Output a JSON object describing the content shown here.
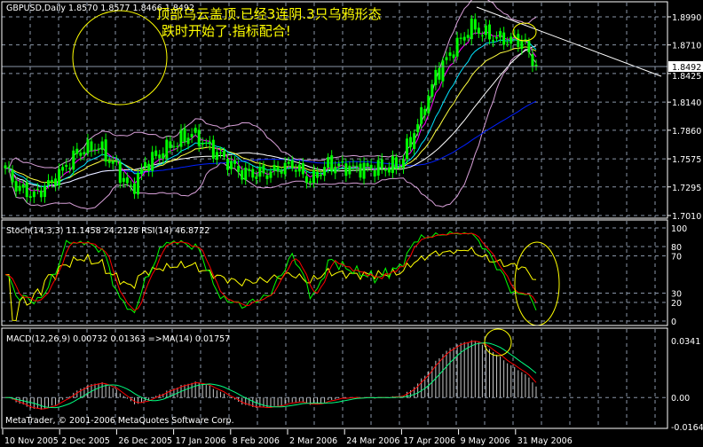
{
  "header": {
    "symbol": "GBPUSD,Daily",
    "ohlc": "1.8570 1.8577 1.8466 1.8492"
  },
  "annotation": {
    "line1": "顶部乌云盖顶.已经3连阴.3只乌鸦形态",
    "line2": "跌时开始了.指标配合!"
  },
  "colors": {
    "background": "#000000",
    "grid": "#8a96a8",
    "candle": "#00ff00",
    "annotation": "#ffff00",
    "bollinger": "#d8a0d8",
    "ma_fast": "#ff00ff",
    "ma_cyan": "#00e5ff",
    "ma_yellow": "#ffff40",
    "ma_white": "#ffffff",
    "ma_blue": "#0020ff",
    "stoch_main": "#00ff00",
    "stoch_signal": "#ff0000",
    "rsi": "#ffff00",
    "macd_hist": "#c8c8c8",
    "macd_red": "#ff0000",
    "macd_green": "#00ff80"
  },
  "chart_data": [
    {
      "type": "candlestick",
      "title": "GBPUSD,Daily",
      "price_axis_ticks": [
        "1.8990",
        "1.8710",
        "1.8425",
        "1.8140",
        "1.7860",
        "1.7575",
        "1.7295",
        "1.7010"
      ],
      "current_price": "1.8492",
      "ylim": [
        1.701,
        1.899
      ],
      "date_ticks": [
        "10 Nov 2005",
        "2 Dec 2005",
        "26 Dec 2005",
        "17 Jan 2006",
        "8 Feb 2006",
        "2 Mar 2006",
        "24 Mar 2006",
        "17 Apr 2006",
        "9 May 2006",
        "31 May 2006"
      ],
      "approx_close_path": [
        [
          "2005-11-10",
          1.748
        ],
        [
          "2005-11-15",
          1.73
        ],
        [
          "2005-11-22",
          1.721
        ],
        [
          "2005-11-29",
          1.735
        ],
        [
          "2005-12-09",
          1.766
        ],
        [
          "2005-12-16",
          1.77
        ],
        [
          "2005-12-23",
          1.748
        ],
        [
          "2005-12-29",
          1.726
        ],
        [
          "2006-01-04",
          1.752
        ],
        [
          "2006-01-13",
          1.77
        ],
        [
          "2006-01-23",
          1.783
        ],
        [
          "2006-01-31",
          1.766
        ],
        [
          "2006-02-10",
          1.743
        ],
        [
          "2006-02-21",
          1.743
        ],
        [
          "2006-03-02",
          1.752
        ],
        [
          "2006-03-09",
          1.735
        ],
        [
          "2006-03-16",
          1.752
        ],
        [
          "2006-03-27",
          1.748
        ],
        [
          "2006-04-06",
          1.748
        ],
        [
          "2006-04-13",
          1.752
        ],
        [
          "2006-04-20",
          1.792
        ],
        [
          "2006-04-25",
          1.819
        ],
        [
          "2006-04-27",
          1.841
        ],
        [
          "2006-05-04",
          1.867
        ],
        [
          "2006-05-11",
          1.889
        ],
        [
          "2006-05-18",
          1.88
        ],
        [
          "2006-05-25",
          1.876
        ],
        [
          "2006-05-31",
          1.876
        ],
        [
          "2006-06-02",
          1.863
        ],
        [
          "2006-06-06",
          1.8492
        ]
      ],
      "overlays": [
        "Bollinger Bands",
        "Moving averages",
        "Trendline"
      ]
    },
    {
      "type": "line",
      "title": "Stoch(14,3,3) 11.1458 24.2128  RSI(14) 46.8722",
      "ticks": [
        "100",
        "80",
        "70",
        "30",
        "20",
        "0"
      ],
      "ylim": [
        0,
        100
      ],
      "series": [
        {
          "name": "Stoch(14,3,3) main",
          "last": 11.1458
        },
        {
          "name": "Stoch(14,3,3) signal",
          "last": 24.2128
        },
        {
          "name": "RSI(14)",
          "last": 46.8722
        }
      ]
    },
    {
      "type": "bar",
      "title": "MACD(12,26,9) 0.00732 0.01363  =>MA(14) 0.01757",
      "ticks": [
        "0.0341",
        "0.00",
        "-0.0164"
      ],
      "ylim": [
        -0.0164,
        0.0341
      ],
      "series": [
        {
          "name": "MACD(12,26,9)",
          "last": 0.00732
        },
        {
          "name": "Signal",
          "last": 0.01363
        },
        {
          "name": "=>MA(14)",
          "last": 0.01757
        }
      ]
    }
  ],
  "footer": {
    "copyright": "MetaTrader, © 2001-2006 MetaQuotes Software Corp."
  }
}
